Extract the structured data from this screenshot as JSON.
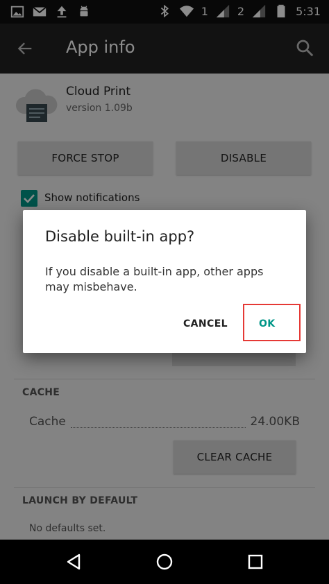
{
  "status_bar": {
    "time": "5:31",
    "sim1": "1",
    "sim2": "2",
    "icons": [
      "image-icon",
      "gmail-icon",
      "upload-icon",
      "android-icon",
      "bluetooth-icon",
      "wifi-icon",
      "signal-icon",
      "battery-icon"
    ]
  },
  "app_bar": {
    "title": "App info",
    "back_icon": "arrow-left-icon",
    "search_icon": "search-icon"
  },
  "app": {
    "name": "Cloud Print",
    "version": "version 1.09b"
  },
  "buttons": {
    "force_stop": "FORCE STOP",
    "disable": "DISABLE",
    "clear_cache": "CLEAR CACHE"
  },
  "notifications": {
    "label": "Show notifications",
    "checked": true
  },
  "cache": {
    "header": "CACHE",
    "label": "Cache",
    "value": "24.00KB"
  },
  "launch": {
    "header": "LAUNCH BY DEFAULT",
    "text": "No defaults set."
  },
  "dialog": {
    "title": "Disable built-in app?",
    "message": "If you disable a built-in app, other apps may misbehave.",
    "cancel": "CANCEL",
    "ok": "OK"
  },
  "colors": {
    "accent": "#009688",
    "highlight": "#e53935"
  }
}
